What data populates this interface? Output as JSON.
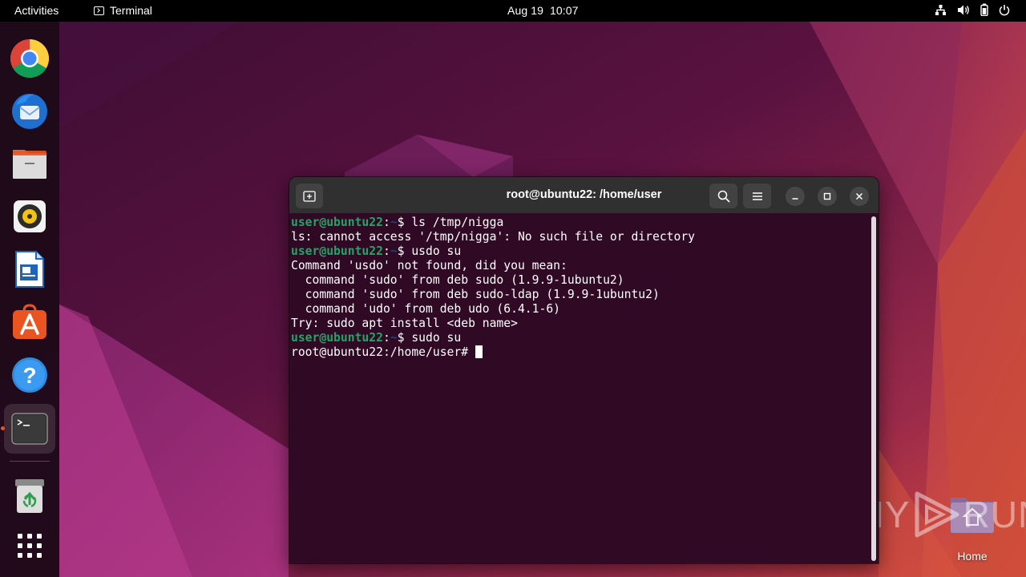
{
  "topbar": {
    "activities": "Activities",
    "app_name": "Terminal",
    "date": "Aug 19",
    "time": "10:07",
    "status_icons": [
      "network-icon",
      "volume-icon",
      "battery-icon",
      "power-icon"
    ]
  },
  "dock": {
    "items": [
      {
        "name": "chrome-icon",
        "label": "Google Chrome"
      },
      {
        "name": "thunderbird-icon",
        "label": "Thunderbird Mail"
      },
      {
        "name": "files-icon",
        "label": "Files"
      },
      {
        "name": "rhythmbox-icon",
        "label": "Rhythmbox"
      },
      {
        "name": "libreoffice-writer-icon",
        "label": "LibreOffice Writer"
      },
      {
        "name": "app-center-icon",
        "label": "Ubuntu Software"
      },
      {
        "name": "help-icon",
        "label": "Help"
      },
      {
        "name": "terminal-icon",
        "label": "Terminal",
        "active": true
      },
      {
        "name": "trash-icon",
        "label": "Trash"
      },
      {
        "name": "show-apps-icon",
        "label": "Show Applications"
      }
    ]
  },
  "desktop": {
    "home_label": "Home"
  },
  "watermark": {
    "left_text": "ANY",
    "right_text": "RUN"
  },
  "terminal": {
    "title": "root@ubuntu22: /home/user",
    "lines": [
      {
        "user": "user@ubuntu22",
        "sep": ":",
        "path": "~",
        "cmd": "$ ls /tmp/nigga"
      },
      {
        "text": "ls: cannot access '/tmp/nigga': No such file or directory"
      },
      {
        "user": "user@ubuntu22",
        "sep": ":",
        "path": "~",
        "cmd": "$ usdo su"
      },
      {
        "text": "Command 'usdo' not found, did you mean:"
      },
      {
        "text": "  command 'sudo' from deb sudo (1.9.9-1ubuntu2)"
      },
      {
        "text": "  command 'sudo' from deb sudo-ldap (1.9.9-1ubuntu2)"
      },
      {
        "text": "  command 'udo' from deb udo (6.4.1-6)"
      },
      {
        "text": "Try: sudo apt install <deb name>"
      },
      {
        "user": "user@ubuntu22",
        "sep": ":",
        "path": "~",
        "cmd": "$ sudo su"
      },
      {
        "text": "root@ubuntu22:/home/user# "
      }
    ]
  },
  "colors": {
    "prompt_user": "#26a269",
    "prompt_path": "#12488b",
    "terminal_bg": "#300a24",
    "header_bg": "#303030",
    "accent": "#e95420"
  }
}
